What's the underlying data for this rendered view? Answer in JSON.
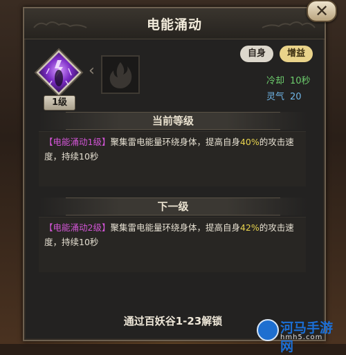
{
  "window": {
    "title": "电能涌动",
    "close_label": "✕"
  },
  "skill": {
    "level_badge": "1级",
    "tags": {
      "self": "自身",
      "buff": "增益"
    },
    "cooldown_label": "冷却",
    "cooldown_value": "10秒",
    "spirit_label": "灵气",
    "spirit_value": "20"
  },
  "current_level": {
    "header": "当前等级",
    "name": "【电能涌动1级】",
    "text_before": "聚集雷电能量环绕身体，提高自身",
    "highlight": "40%",
    "text_after": "的攻击速度，持续10秒"
  },
  "next_level": {
    "header": "下一级",
    "name": "【电能涌动2级】",
    "text_before": "聚集雷电能量环绕身体，提高自身",
    "highlight": "42%",
    "text_after": "的攻击速度，持续10秒"
  },
  "footer": {
    "unlock_text": "通过百妖谷1-23解锁"
  },
  "watermark": {
    "title": "河马手游网",
    "url": "hmh5.com"
  },
  "colors": {
    "skill_name": "#d255d6",
    "highlight": "#e7d34e",
    "cooldown": "#6ecf6e",
    "spirit": "#6fb6e8",
    "tag_self_bg": "#dcd7cc",
    "tag_buff_bg": "#e9d38a"
  }
}
